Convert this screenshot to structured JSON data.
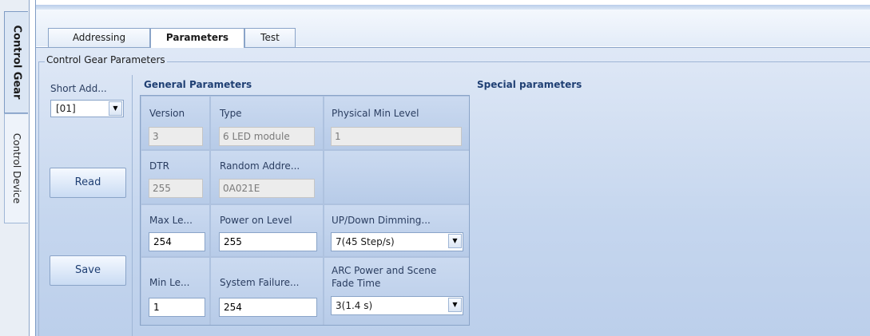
{
  "side_tabs": {
    "control_gear": "Control Gear",
    "control_device": "Control Device"
  },
  "tabs": [
    {
      "label": "Addressing"
    },
    {
      "label": "Parameters"
    },
    {
      "label": "Test"
    }
  ],
  "group_title": "Control Gear Parameters",
  "short_address": {
    "label": "Short Add...",
    "value": "[01]"
  },
  "buttons": {
    "read": "Read",
    "save": "Save"
  },
  "general": {
    "title": "General Parameters",
    "version_label": "Version",
    "version_value": "3",
    "type_label": "Type",
    "type_value": "6 LED module",
    "phys_min_label": "Physical Min Level",
    "phys_min_value": "1",
    "dtr_label": "DTR",
    "dtr_value": "255",
    "random_addr_label": "Random Addre...",
    "random_addr_value": "0A021E",
    "max_level_label": "Max Le...",
    "max_level_value": "254",
    "power_on_label": "Power on Level",
    "power_on_value": "255",
    "updown_label": "UP/Down  Dimming...",
    "updown_value": "7(45 Step/s)",
    "min_level_label": "Min Le...",
    "min_level_value": "1",
    "sys_failure_label": "System Failure...",
    "sys_failure_value": "254",
    "fade_label": "ARC Power and Scene Fade Time",
    "fade_value": "3(1.4 s)"
  },
  "special": {
    "title": "Special parameters"
  }
}
